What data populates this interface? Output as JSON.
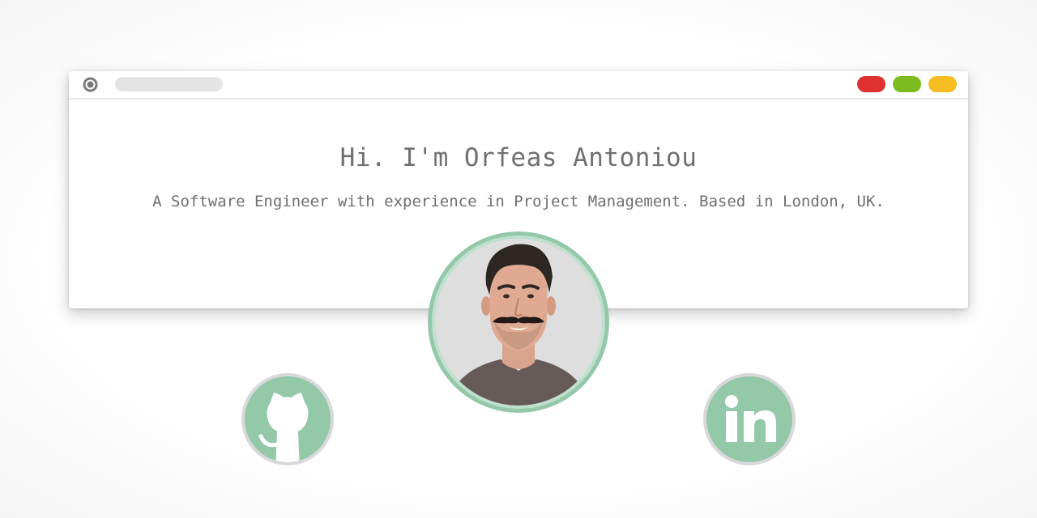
{
  "header": {
    "title": "Hi. I'm Orfeas Antoniou",
    "tagline": "A Software Engineer with experience in Project Management. Based in London, UK."
  },
  "window": {
    "controls": [
      {
        "name": "red",
        "color": "#e03131"
      },
      {
        "name": "green",
        "color": "#7cba1f"
      },
      {
        "name": "yellow",
        "color": "#f5bd22"
      }
    ],
    "menu_icon": "radio-button-icon"
  },
  "avatar": {
    "ring_color": "#93c8a9",
    "background": "#dedede"
  },
  "social": [
    {
      "name": "github",
      "icon": "github-icon",
      "color": "#93c8a9",
      "border": "#d9d9d9"
    },
    {
      "name": "linkedin",
      "icon": "linkedin-icon",
      "color": "#93c8a9",
      "border": "#d9d9d9"
    }
  ]
}
